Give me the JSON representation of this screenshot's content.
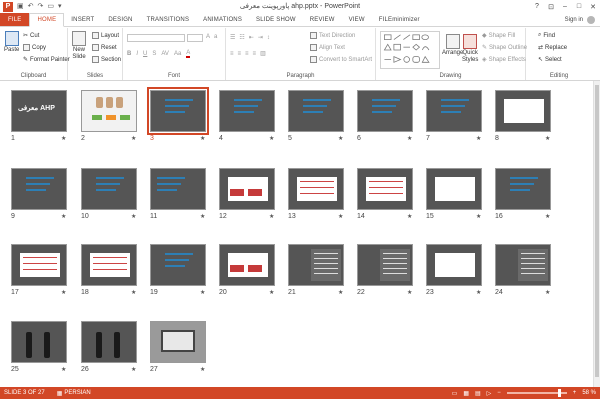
{
  "titlebar": {
    "title": "پاورپوینت معرفی ahp.pptx - PowerPoint",
    "app_icon": "P",
    "qat_icons": [
      "save-icon",
      "undo-icon",
      "redo-icon",
      "slideshow-icon",
      "customize-icon"
    ],
    "controls": {
      "help": "?",
      "ribbon_opts": "⊡",
      "minimize": "–",
      "maximize": "□",
      "close": "✕"
    }
  },
  "tabs": [
    "FILE",
    "HOME",
    "INSERT",
    "DESIGN",
    "TRANSITIONS",
    "ANIMATIONS",
    "SLIDE SHOW",
    "REVIEW",
    "VIEW",
    "FILEminimizer"
  ],
  "active_tab": "HOME",
  "signin": "Sign in",
  "ribbon": {
    "clipboard": {
      "label": "Clipboard",
      "paste": "Paste",
      "cut": "Cut",
      "copy": "Copy",
      "format_painter": "Format Painter"
    },
    "slides": {
      "label": "Slides",
      "new_slide": "New",
      "new_slide2": "Slide",
      "layout": "Layout",
      "reset": "Reset",
      "section": "Section"
    },
    "font": {
      "label": "Font"
    },
    "paragraph": {
      "label": "Paragraph",
      "text_direction": "Text Direction",
      "align_text": "Align Text",
      "convert": "Convert to SmartArt"
    },
    "drawing": {
      "label": "Drawing",
      "arrange": "Arrange",
      "quick_styles": "Quick",
      "quick_styles2": "Styles",
      "shape_fill": "Shape Fill",
      "shape_outline": "Shape Outline",
      "shape_effects": "Shape Effects"
    },
    "editing": {
      "label": "Editing",
      "find": "Find",
      "replace": "Replace",
      "select": "Select"
    }
  },
  "slides": [
    {
      "n": "1",
      "title": "معرفی AHP"
    },
    {
      "n": "2"
    },
    {
      "n": "3"
    },
    {
      "n": "4"
    },
    {
      "n": "5"
    },
    {
      "n": "6"
    },
    {
      "n": "7"
    },
    {
      "n": "8"
    },
    {
      "n": "9"
    },
    {
      "n": "10"
    },
    {
      "n": "11"
    },
    {
      "n": "12"
    },
    {
      "n": "13"
    },
    {
      "n": "14"
    },
    {
      "n": "15"
    },
    {
      "n": "16"
    },
    {
      "n": "17"
    },
    {
      "n": "18"
    },
    {
      "n": "19"
    },
    {
      "n": "20"
    },
    {
      "n": "21"
    },
    {
      "n": "22"
    },
    {
      "n": "23"
    },
    {
      "n": "24"
    },
    {
      "n": "25"
    },
    {
      "n": "26"
    },
    {
      "n": "27"
    }
  ],
  "selected_slide": "3",
  "transition_mark": "★",
  "status": {
    "slide_info": "SLIDE 3 OF 27",
    "language": "PERSIAN",
    "zoom": "58 %",
    "zoom_level": 0.58
  },
  "colors": {
    "accent": "#d24726"
  }
}
